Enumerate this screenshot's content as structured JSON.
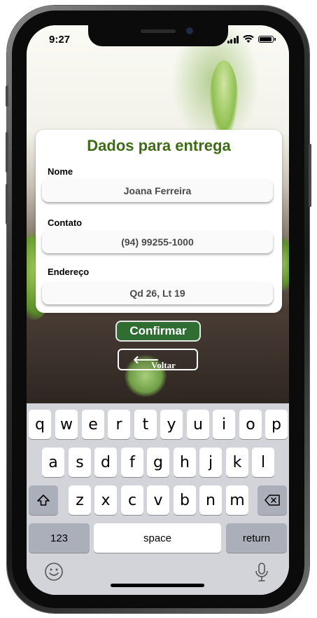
{
  "status": {
    "time": "9:27"
  },
  "form": {
    "title": "Dados para entrega",
    "name_label": "Nome",
    "name_value": "Joana Ferreira",
    "contact_label": "Contato",
    "contact_value": "(94) 99255-1000",
    "address_label": "Endereço",
    "address_value": "Qd 26, Lt 19"
  },
  "actions": {
    "confirm_label": "Confirmar",
    "back_label": "Voltar"
  },
  "keyboard": {
    "row1": [
      "q",
      "w",
      "e",
      "r",
      "t",
      "y",
      "u",
      "i",
      "o",
      "p"
    ],
    "row2": [
      "a",
      "s",
      "d",
      "f",
      "g",
      "h",
      "j",
      "k",
      "l"
    ],
    "row3": [
      "z",
      "x",
      "c",
      "v",
      "b",
      "n",
      "m"
    ],
    "numbers_label": "123",
    "space_label": "space",
    "return_label": "return"
  },
  "colors": {
    "title_green": "#3e6b16",
    "confirm_green": "#2f6d33",
    "keyboard_bg": "#d2d4da"
  }
}
